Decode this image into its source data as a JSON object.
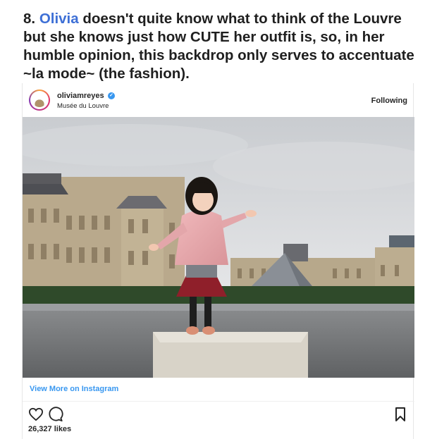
{
  "headline": {
    "number": "8.",
    "name_link": "Olivia",
    "text": "doesn't quite know what to think of the Louvre but she knows just how CUTE her outfit is, so, in her humble opinion, this backdrop only serves to accentuate ~la mode~ (the fashion)."
  },
  "post": {
    "username": "oliviamreyes",
    "location": "Musée du Louvre",
    "follow_status": "Following",
    "view_more": "View More on Instagram",
    "likes": "26,327 likes"
  },
  "colors": {
    "link": "#3d6fd6",
    "instagram_blue": "#3897f0",
    "verified_badge": "#3897f0"
  },
  "icons": [
    "heart-icon",
    "comment-icon",
    "bookmark-icon",
    "verified-icon"
  ]
}
